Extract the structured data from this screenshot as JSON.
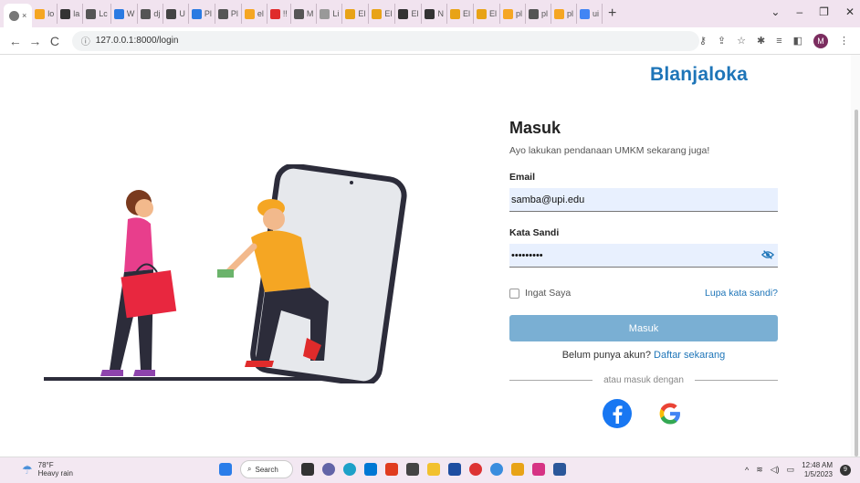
{
  "browser": {
    "active_tab_close": "×",
    "tabs": [
      "lo",
      "la",
      "Lc",
      "W",
      "dj",
      "U",
      "Pl",
      "Pl",
      "el",
      "!!",
      "M",
      "Li",
      "El",
      "El",
      "El",
      "N",
      "El",
      "El",
      "pl",
      "pl",
      "pl",
      "ui"
    ],
    "url": "127.0.0.1:8000/login",
    "profile_initial": "M",
    "new_tab": "+",
    "window_controls": [
      "⌄",
      "–",
      "❐",
      "✕"
    ]
  },
  "brand": {
    "name": "Blanjaloka"
  },
  "form": {
    "title": "Masuk",
    "subtitle": "Ayo lakukan pendanaan UMKM sekarang juga!",
    "email_label": "Email",
    "email_value": "samba@upi.edu",
    "password_label": "Kata Sandi",
    "password_value": "•••••••••",
    "remember_label": "Ingat Saya",
    "forgot_link": "Lupa kata sandi?",
    "submit_label": "Masuk",
    "register_prompt": "Belum punya akun?",
    "register_link": "Daftar sekarang",
    "divider_text": "atau masuk dengan"
  },
  "colors": {
    "accent": "#1e75b8",
    "button": "#7aafd3",
    "input_bg": "#e8f0fe"
  },
  "taskbar": {
    "temp": "78°F",
    "weather": "Heavy rain",
    "search_label": "Search",
    "time": "12:48 AM",
    "date": "1/5/2023",
    "notification_count": "9"
  }
}
